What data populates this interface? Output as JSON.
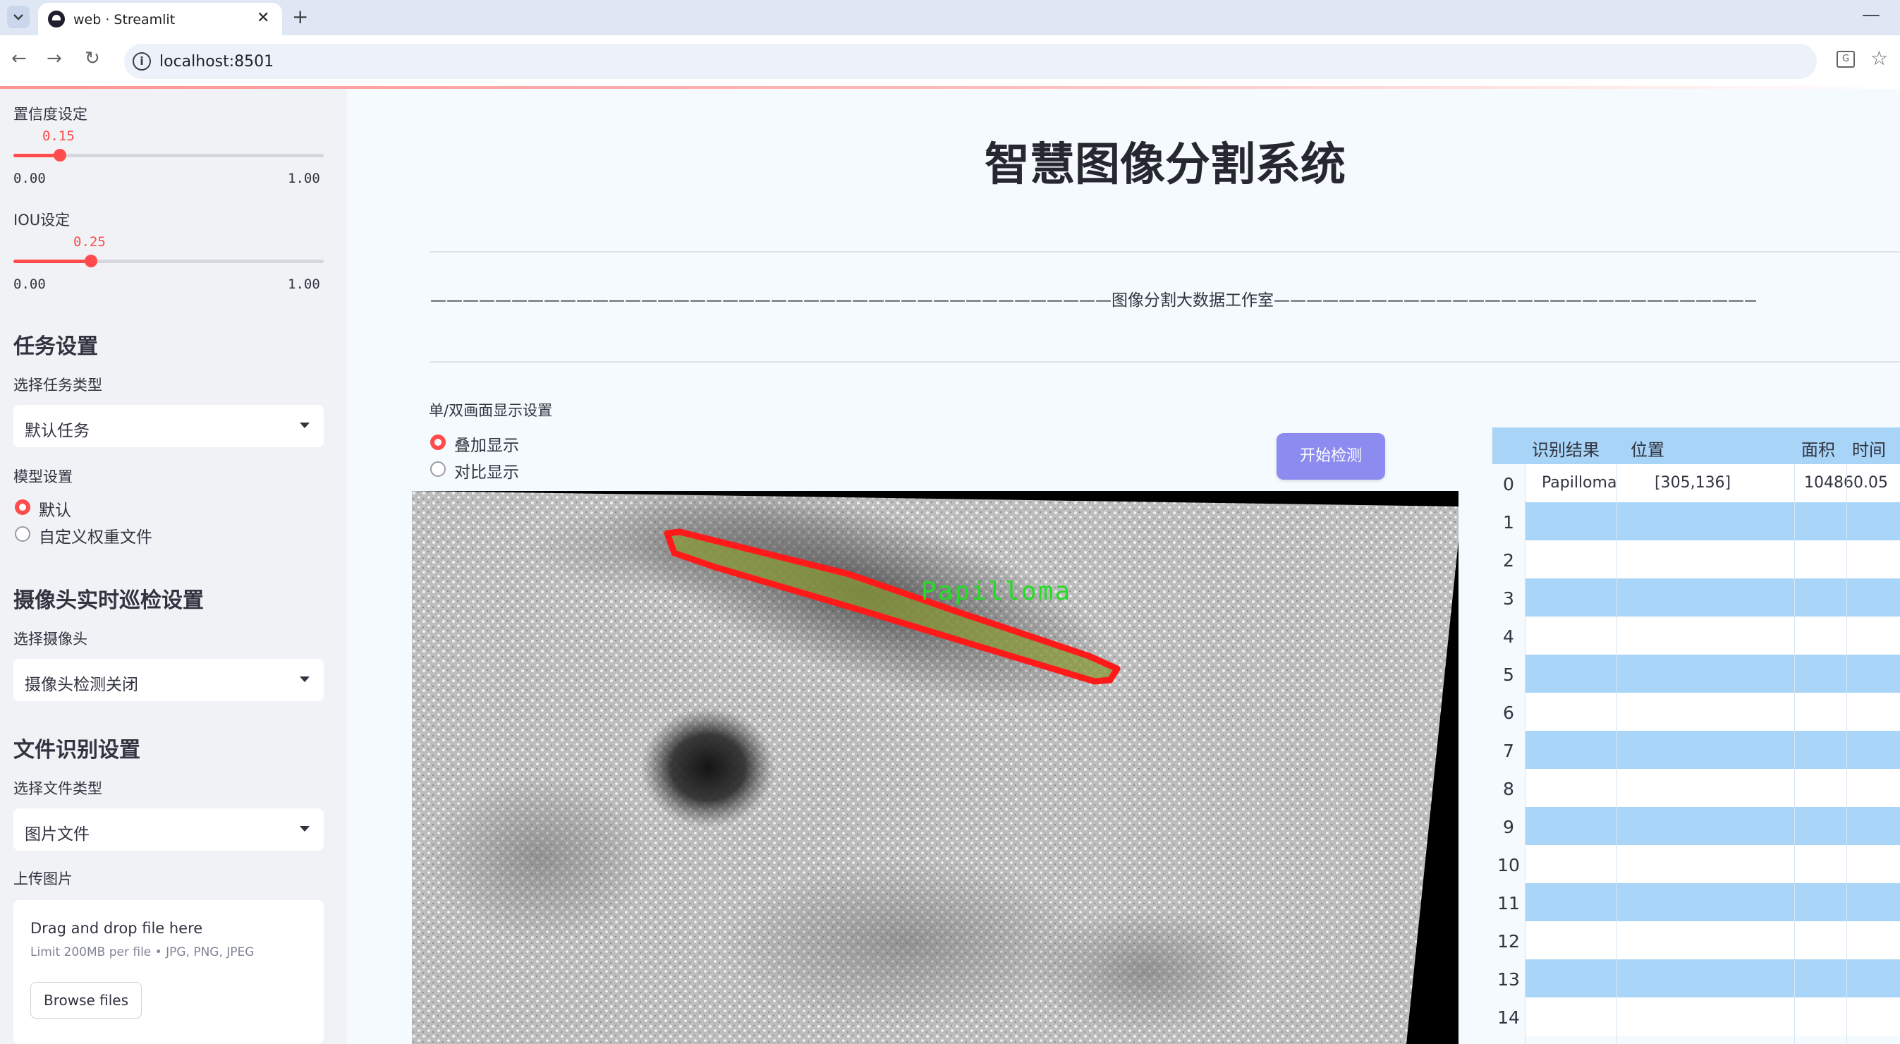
{
  "browser": {
    "tab_title": "web · Streamlit",
    "tab_close": "✕",
    "new_tab": "+",
    "minimize": "—",
    "url": "localhost:8501",
    "nav": {
      "back": "←",
      "forward": "→",
      "reload": "↻"
    },
    "info": "i",
    "star": "☆",
    "translate": "G"
  },
  "sidebar": {
    "confidence": {
      "label": "置信度设定",
      "value": 0.15,
      "value_text": "0.15",
      "min": "0.00",
      "max": "1.00"
    },
    "iou": {
      "label": "IOU设定",
      "value": 0.25,
      "value_text": "0.25",
      "min": "0.00",
      "max": "1.00"
    },
    "task_heading": "任务设置",
    "task_type_label": "选择任务类型",
    "task_type_value": "默认任务",
    "model_label": "模型设置",
    "model_options": [
      "默认",
      "自定义权重文件"
    ],
    "model_selected": 0,
    "camera_heading": "摄像头实时巡检设置",
    "camera_label": "选择摄像头",
    "camera_value": "摄像头检测关闭",
    "file_heading": "文件识别设置",
    "file_type_label": "选择文件类型",
    "file_type_value": "图片文件",
    "upload_label": "上传图片",
    "upload_title": "Drag and drop file here",
    "upload_limit": "Limit 200MB per file • JPG, PNG, JPEG",
    "browse_button": "Browse files"
  },
  "main": {
    "title": "智慧图像分割系统",
    "studio_line": "——————————————————————————————————————————图像分割大数据工作室——————————————————————————————————————————",
    "display_mode_label": "单/双画面显示设置",
    "display_options": [
      "叠加显示",
      "对比显示"
    ],
    "display_selected": 0,
    "start_button": "开始检测",
    "detection_label": "Papilloma"
  },
  "table": {
    "columns": [
      "识别结果",
      "位置",
      "面积",
      "时间"
    ],
    "rows": [
      {
        "index": "0",
        "result": "Papilloma",
        "position": "[305,136]",
        "area": "10486",
        "time": "0.05"
      },
      {
        "index": "1"
      },
      {
        "index": "2"
      },
      {
        "index": "3"
      },
      {
        "index": "4"
      },
      {
        "index": "5"
      },
      {
        "index": "6"
      },
      {
        "index": "7"
      },
      {
        "index": "8"
      },
      {
        "index": "9"
      },
      {
        "index": "10"
      },
      {
        "index": "11"
      },
      {
        "index": "12"
      },
      {
        "index": "13"
      },
      {
        "index": "14"
      }
    ]
  },
  "colors": {
    "accent": "#ff4b4b",
    "sidebar_bg": "#f0f2f6",
    "main_bg": "#f4fafd",
    "button": "#8c8cf0",
    "table_header": "#a7d4f7",
    "table_stripe": "#a9d6f8",
    "mask_outline": "#ff1a1a",
    "mask_fill": "#8a9a3a",
    "label_text": "#22dd22"
  }
}
